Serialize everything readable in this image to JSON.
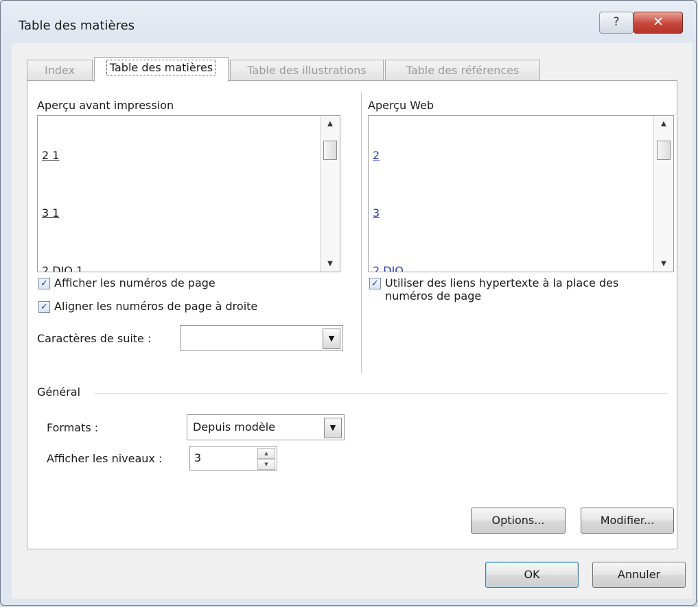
{
  "window": {
    "title": "Table des matières",
    "help_glyph": "?",
    "close_glyph": "✕"
  },
  "tabs": [
    {
      "label": "Index"
    },
    {
      "label": "Table des matières"
    },
    {
      "label": "Table des illustrations"
    },
    {
      "label": "Table des références"
    }
  ],
  "print_preview": {
    "label": "Aperçu avant impression",
    "lines": [
      "2 1",
      "3 1",
      "2 DIO 1"
    ]
  },
  "web_preview": {
    "label": "Aperçu Web",
    "lines": [
      "2",
      "3",
      "2 DIO"
    ],
    "link_color": "#2b3fc4"
  },
  "options": {
    "show_page_numbers": {
      "label": "Afficher les numéros de page",
      "checked": true
    },
    "align_right": {
      "label": "Aligner les numéros de page à droite",
      "checked": true
    },
    "tab_leader": {
      "label": "Caractères de suite :",
      "value": ""
    },
    "use_hyperlinks": {
      "label_line1": "Utiliser des liens hypertexte à la place des",
      "label_line2": "numéros de page",
      "checked": true
    }
  },
  "general": {
    "heading": "Général",
    "formats": {
      "label": "Formats :",
      "value": "Depuis modèle"
    },
    "levels": {
      "label": "Afficher les niveaux :",
      "value": "3"
    }
  },
  "buttons": {
    "options": "Options...",
    "modify": "Modifier...",
    "ok": "OK",
    "cancel": "Annuler"
  },
  "checkmark": "✓",
  "arrow_down": "▼",
  "arrow_up_small": "▲"
}
